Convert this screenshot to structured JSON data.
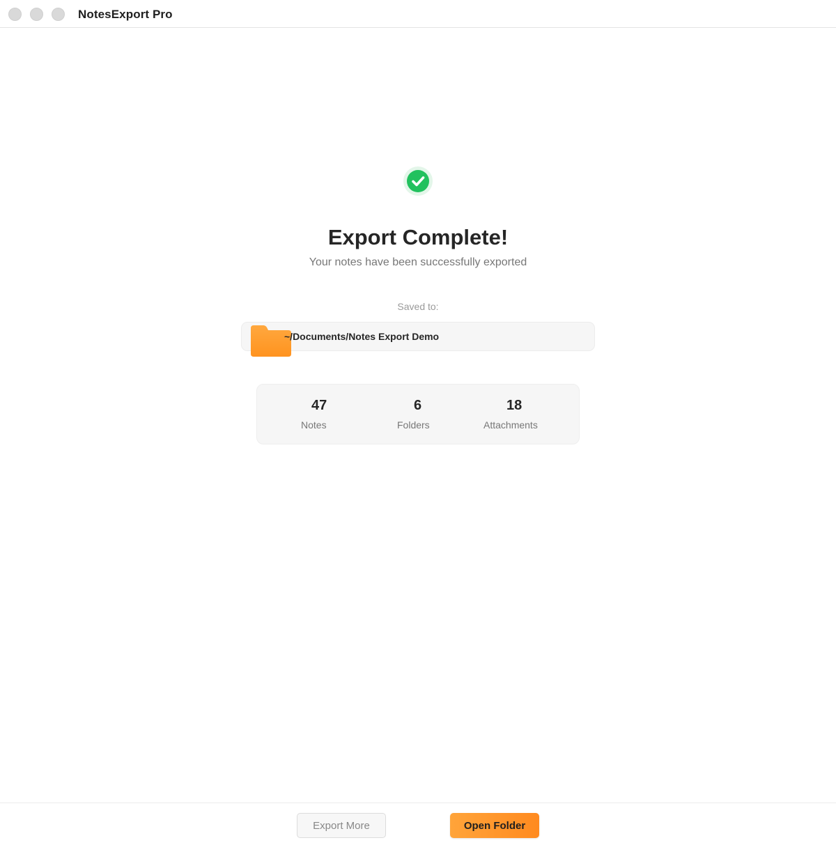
{
  "window": {
    "app_title": "NotesExport Pro"
  },
  "result": {
    "icon": "check-circle-icon",
    "headline": "Export Complete!",
    "subhead": "Your notes have been successfully exported",
    "saved_label": "Saved to:",
    "path_icon": "folder-icon",
    "path": "~/Documents/Notes Export Demo"
  },
  "stats": [
    {
      "value": "47",
      "label": "Notes"
    },
    {
      "value": "6",
      "label": "Folders"
    },
    {
      "value": "18",
      "label": "Attachments"
    }
  ],
  "footer": {
    "secondary_label": "Export More",
    "primary_label": "Open Folder"
  },
  "colors": {
    "success": "#22c15e",
    "accent": "#ff9a2e",
    "folder": "#ffa43a"
  }
}
